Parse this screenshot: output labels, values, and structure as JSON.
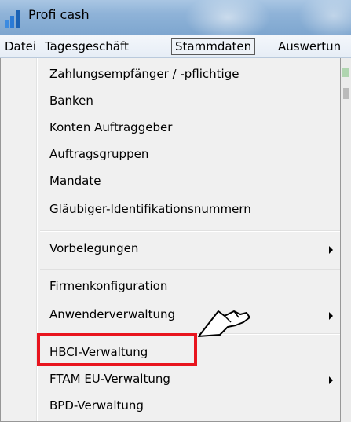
{
  "window": {
    "title": "Profi cash"
  },
  "menubar": {
    "items": [
      "Datei",
      "Tagesgeschäft",
      "Stammdaten",
      "Auswertun"
    ],
    "active": "Stammdaten"
  },
  "dropdown": {
    "items": [
      {
        "label": "Zahlungsempfänger / -pflichtige",
        "submenu": false
      },
      {
        "label": "Banken",
        "submenu": false
      },
      {
        "label": "Konten Auftraggeber",
        "submenu": false
      },
      {
        "label": "Auftragsgruppen",
        "submenu": false
      },
      {
        "label": "Mandate",
        "submenu": false
      },
      {
        "label": "Gläubiger-Identifikationsnummern",
        "submenu": false
      },
      {
        "label": "Vorbelegungen",
        "submenu": true
      },
      {
        "label": "Firmenkonfiguration",
        "submenu": false
      },
      {
        "label": "Anwenderverwaltung",
        "submenu": true
      },
      {
        "label": "HBCI-Verwaltung",
        "submenu": false,
        "highlighted": true
      },
      {
        "label": "FTAM EU-Verwaltung",
        "submenu": true
      },
      {
        "label": "BPD-Verwaltung",
        "submenu": false
      }
    ]
  },
  "colors": {
    "highlight_border": "#e8141e",
    "menu_background": "#f0f0f0",
    "titlebar": "#8fb3d8"
  },
  "icons": {
    "app": "bar-chart-icon",
    "submenu": "submenu-arrow-icon",
    "cursor": "hand-pointer-cursor-icon"
  }
}
